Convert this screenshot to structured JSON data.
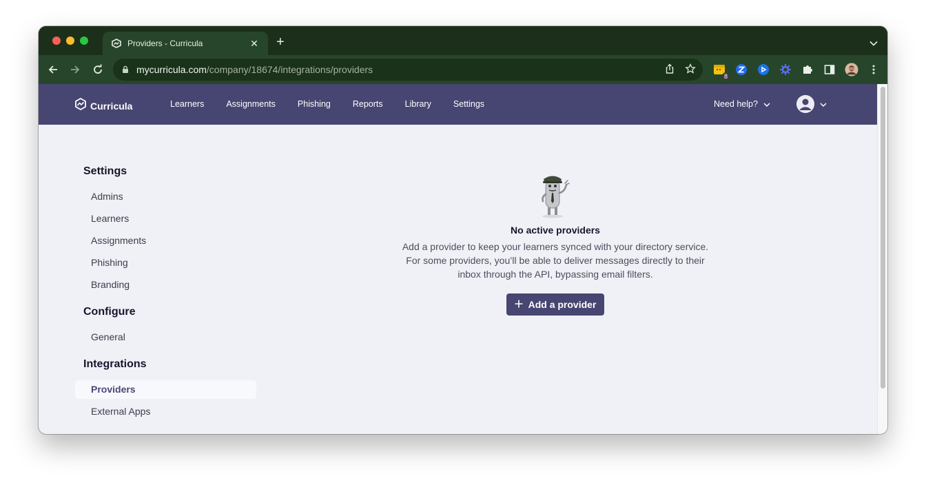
{
  "browser": {
    "tab_title": "Providers - Curricula",
    "url_host": "mycurricula.com",
    "url_path": "/company/18674/integrations/providers",
    "extension_badge": "8"
  },
  "app": {
    "brand": "Curricula",
    "nav": [
      "Learners",
      "Assignments",
      "Phishing",
      "Reports",
      "Library",
      "Settings"
    ],
    "help_label": "Need help?"
  },
  "sidebar": {
    "sections": [
      {
        "title": "Settings",
        "items": [
          "Admins",
          "Learners",
          "Assignments",
          "Phishing",
          "Branding"
        ]
      },
      {
        "title": "Configure",
        "items": [
          "General"
        ]
      },
      {
        "title": "Integrations",
        "items": [
          "Providers",
          "External Apps"
        ]
      }
    ],
    "active_item": "Providers"
  },
  "empty_state": {
    "title": "No active providers",
    "description": "Add a provider to keep your learners synced with your directory service. For some providers, you’ll be able to deliver messages directly to their inbox through the API, bypassing email filters.",
    "button_label": "Add a provider"
  },
  "colors": {
    "browser_frame": "#1c2f1a",
    "toolbar": "#27452a",
    "app_nav": "#474571",
    "page_bg": "#f0f1f6",
    "accent": "#474571"
  }
}
